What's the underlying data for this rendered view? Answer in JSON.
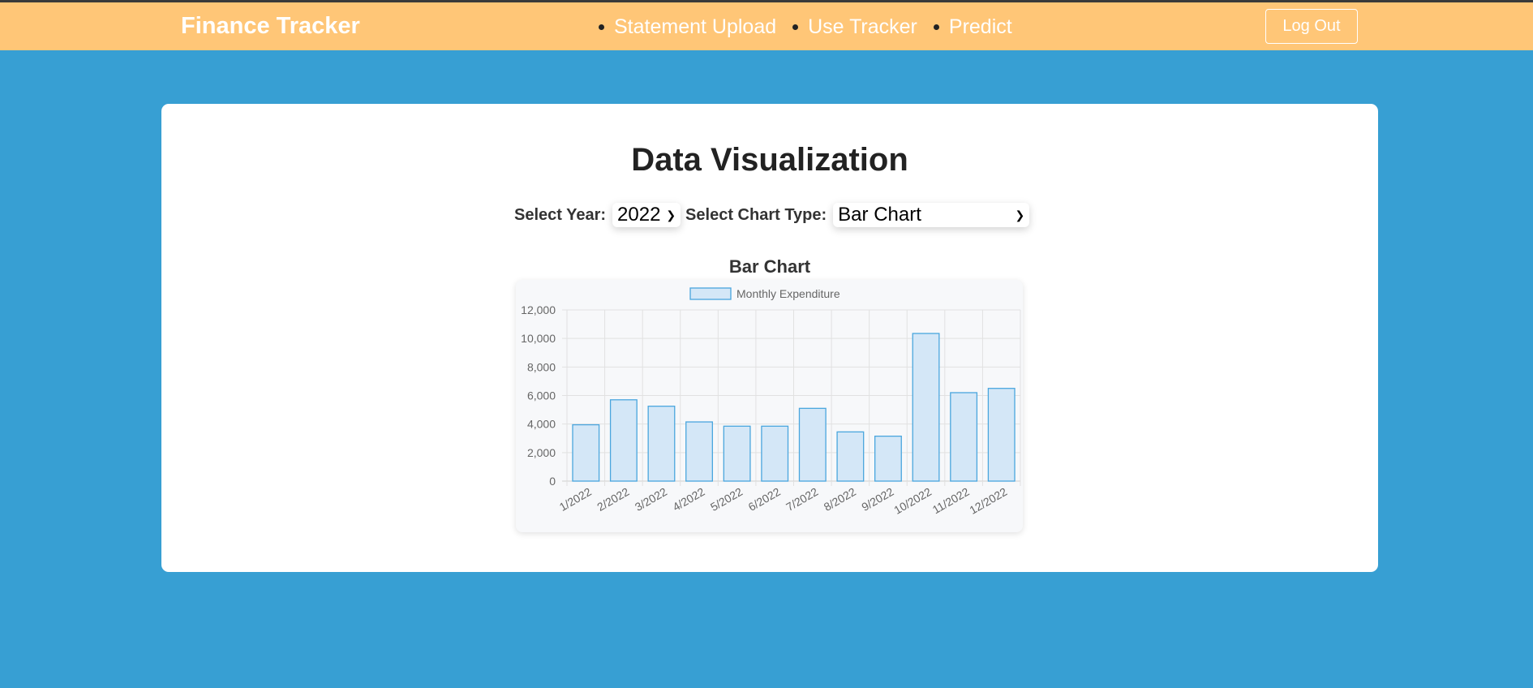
{
  "app": {
    "brand": "Finance Tracker"
  },
  "nav": {
    "items": [
      {
        "label": "Statement Upload"
      },
      {
        "label": "Use Tracker"
      },
      {
        "label": "Predict"
      }
    ],
    "logout_label": "Log Out"
  },
  "page": {
    "title": "Data Visualization",
    "year_label": "Select Year:",
    "year_value": "2022",
    "type_label": "Select Chart Type:",
    "type_value": "Bar Chart",
    "chart_heading": "Bar Chart"
  },
  "colors": {
    "navbar": "#ffc677",
    "background": "#379fd3",
    "bar_fill": "#d4e7f7",
    "bar_stroke": "#4aa6de"
  },
  "chart_data": {
    "type": "bar",
    "title": "Bar Chart",
    "categories": [
      "1/2022",
      "2/2022",
      "3/2022",
      "4/2022",
      "5/2022",
      "6/2022",
      "7/2022",
      "8/2022",
      "9/2022",
      "10/2022",
      "11/2022",
      "12/2022"
    ],
    "series": [
      {
        "name": "Monthly Expenditure",
        "values": [
          3950,
          5700,
          5250,
          4150,
          3850,
          3850,
          5100,
          3450,
          3150,
          10350,
          6200,
          6500
        ]
      }
    ],
    "yticks": [
      "0",
      "2,000",
      "4,000",
      "6,000",
      "8,000",
      "10,000",
      "12,000"
    ],
    "ylim": [
      0,
      12000
    ],
    "legend": "top",
    "grid": true
  }
}
